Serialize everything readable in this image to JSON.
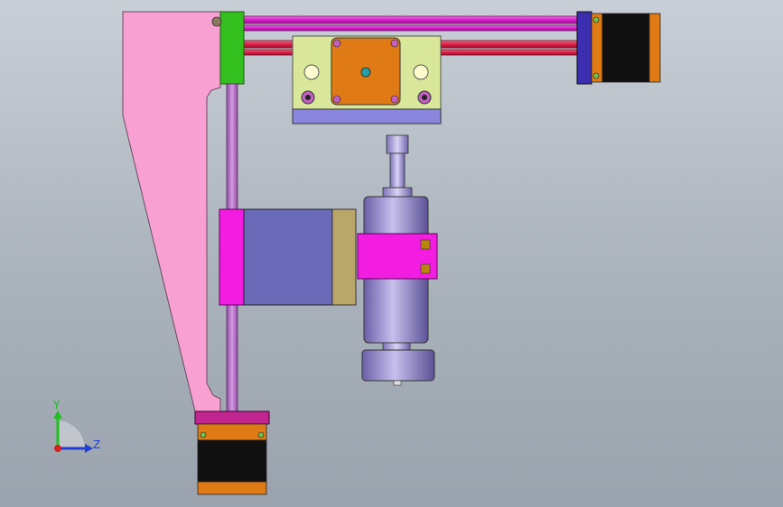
{
  "scene": {
    "view": "cad-assembly-front",
    "background_top": "#c9cfd6",
    "background_bottom": "#9aa3ad"
  },
  "colors": {
    "frame_pink": "#f9a0d2",
    "rail_magenta": "#e01fd0",
    "rail_red": "#e0204a",
    "z_rail": "#b066c0",
    "bracket_green": "#33c01f",
    "plate_yellow": "#d8e79a",
    "plate_blue": "#8a85dd",
    "motor_orange": "#e07a14",
    "motor_black": "#101010",
    "clamp_magenta": "#f21de0",
    "block_blue": "#6a6ab8",
    "block_tan": "#b9a76a",
    "spindle_purple": "#8f84c8",
    "endplate_blue": "#3b2fb0",
    "base_plate": "#c0268f"
  },
  "triad": {
    "y_label": "Y",
    "z_label": "Z",
    "y_color": "#1fbf1f",
    "z_color": "#1f3fd6",
    "x_color": "#d61f1f"
  }
}
